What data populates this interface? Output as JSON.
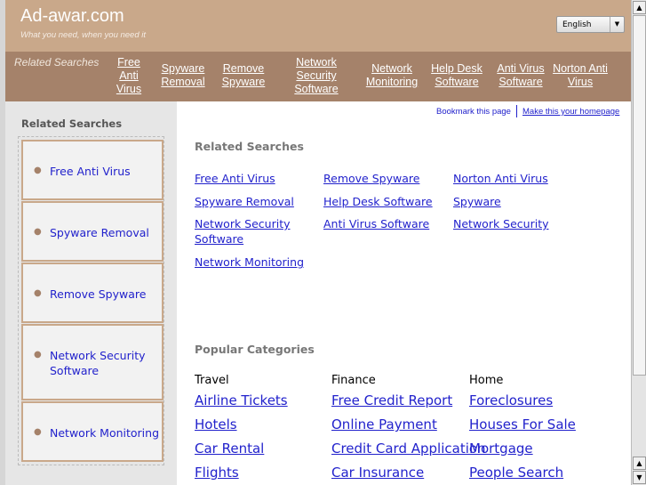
{
  "header": {
    "logo": "Ad-awar.com",
    "tagline": "What you need, when you need it",
    "language": "English"
  },
  "nav": {
    "label": "Related Searches",
    "items": [
      "Free Anti Virus",
      "Spyware Removal",
      "Remove Spyware",
      "Network Security Software",
      "Network Monitoring",
      "Help Desk Software",
      "Anti Virus Software",
      "Norton Anti Virus"
    ]
  },
  "sidebar": {
    "title": "Related Searches",
    "items": [
      "Free Anti Virus",
      "Spyware Removal",
      "Remove Spyware",
      "Network Security Software",
      "Network Monitoring"
    ]
  },
  "top_links": {
    "bookmark": "Bookmark this page",
    "homepage": "Make this your homepage"
  },
  "related": {
    "title": "Related Searches",
    "links": [
      "Free Anti Virus",
      "Spyware Removal",
      "Network Security Software",
      "Network Monitoring",
      "Remove Spyware",
      "Help Desk Software",
      "Anti Virus Software",
      "Norton Anti Virus",
      "Spyware",
      "Network Security"
    ]
  },
  "popular": {
    "title": "Popular Categories",
    "columns": [
      {
        "name": "Travel",
        "links": [
          "Airline Tickets",
          "Hotels",
          "Car Rental",
          "Flights"
        ]
      },
      {
        "name": "Finance",
        "links": [
          "Free Credit Report",
          "Online Payment",
          "Credit Card Application",
          "Car Insurance"
        ]
      },
      {
        "name": "Home",
        "links": [
          "Foreclosures",
          "Houses For Sale",
          "Mortgage",
          "People Search"
        ]
      }
    ]
  }
}
